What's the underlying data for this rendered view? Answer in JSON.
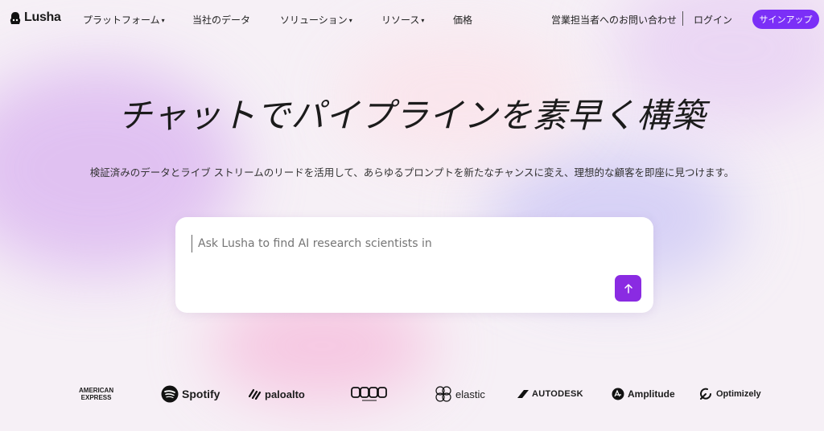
{
  "nav": {
    "logo": "Lusha",
    "items": [
      {
        "label": "プラットフォーム",
        "dropdown": true
      },
      {
        "label": "当社のデータ",
        "dropdown": false
      },
      {
        "label": "ソリューション",
        "dropdown": true
      },
      {
        "label": "リソース",
        "dropdown": true
      },
      {
        "label": "価格",
        "dropdown": false
      }
    ],
    "contact_sales": "営業担当者へのお問い合わせ",
    "login": "ログイン",
    "signup": "サインアップ"
  },
  "hero": {
    "title": "チャットでパイプラインを素早く構築",
    "subtitle": "検証済みのデータとライブ ストリームのリードを活用して、あらゆるプロンプトを新たなチャンスに変え、理想的な顧客を即座に見つけます。"
  },
  "chat": {
    "placeholder": "Ask Lusha to find AI research scientists in",
    "send_icon": "arrow-up-icon"
  },
  "logos": {
    "amex_line1": "AMERICAN",
    "amex_line2": "EXPRESS",
    "spotify": "Spotify",
    "paloalto": "paloalto",
    "elastic": "elastic",
    "autodesk": "AUTODESK",
    "amplitude": "Amplitude",
    "optimizely": "Optimizely"
  },
  "colors": {
    "accent": "#7b2ff7",
    "send_button": "#8a2be2"
  }
}
